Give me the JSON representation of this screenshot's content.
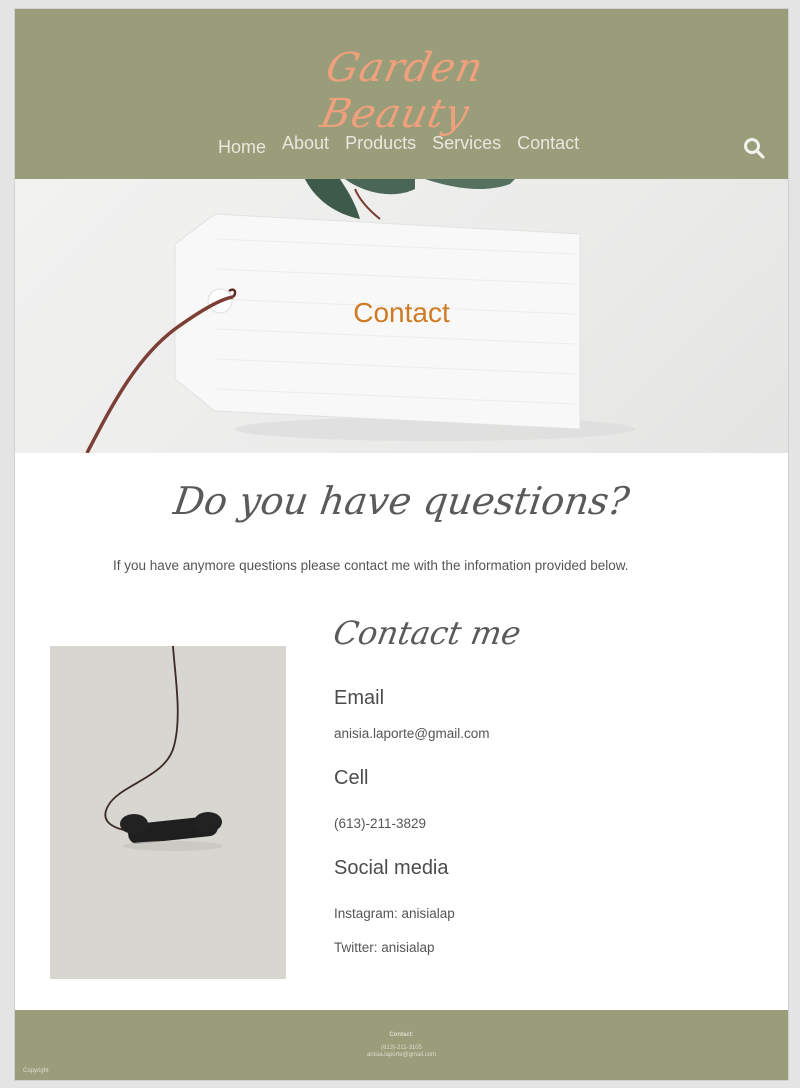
{
  "header": {
    "logo": "Garden Beauty",
    "nav": [
      "Home",
      "About",
      "Products",
      "Services",
      "Contact"
    ],
    "search_icon": "search-icon"
  },
  "hero": {
    "title": "Contact"
  },
  "intro": {
    "heading": "Do you have questions?",
    "text": "If you have anymore questions please contact me with the information provided below."
  },
  "contact": {
    "heading": "Contact me",
    "email_title": "Email",
    "email": "anisia.laporte@gmail.com",
    "cell_title": "Cell",
    "cell": "(613)-211-3829",
    "social_title": "Social media",
    "instagram": "Instagram: anisialap",
    "twitter": "Twitter: anisialap"
  },
  "footer": {
    "label": "Contact:",
    "phone": "(613)-211-3105",
    "email": "anisia.laporte@gmail.com",
    "copyright": "Copyright"
  },
  "colors": {
    "header_bg": "#999d79",
    "logo": "#f0a07d",
    "hero_title": "#cf7a24"
  }
}
